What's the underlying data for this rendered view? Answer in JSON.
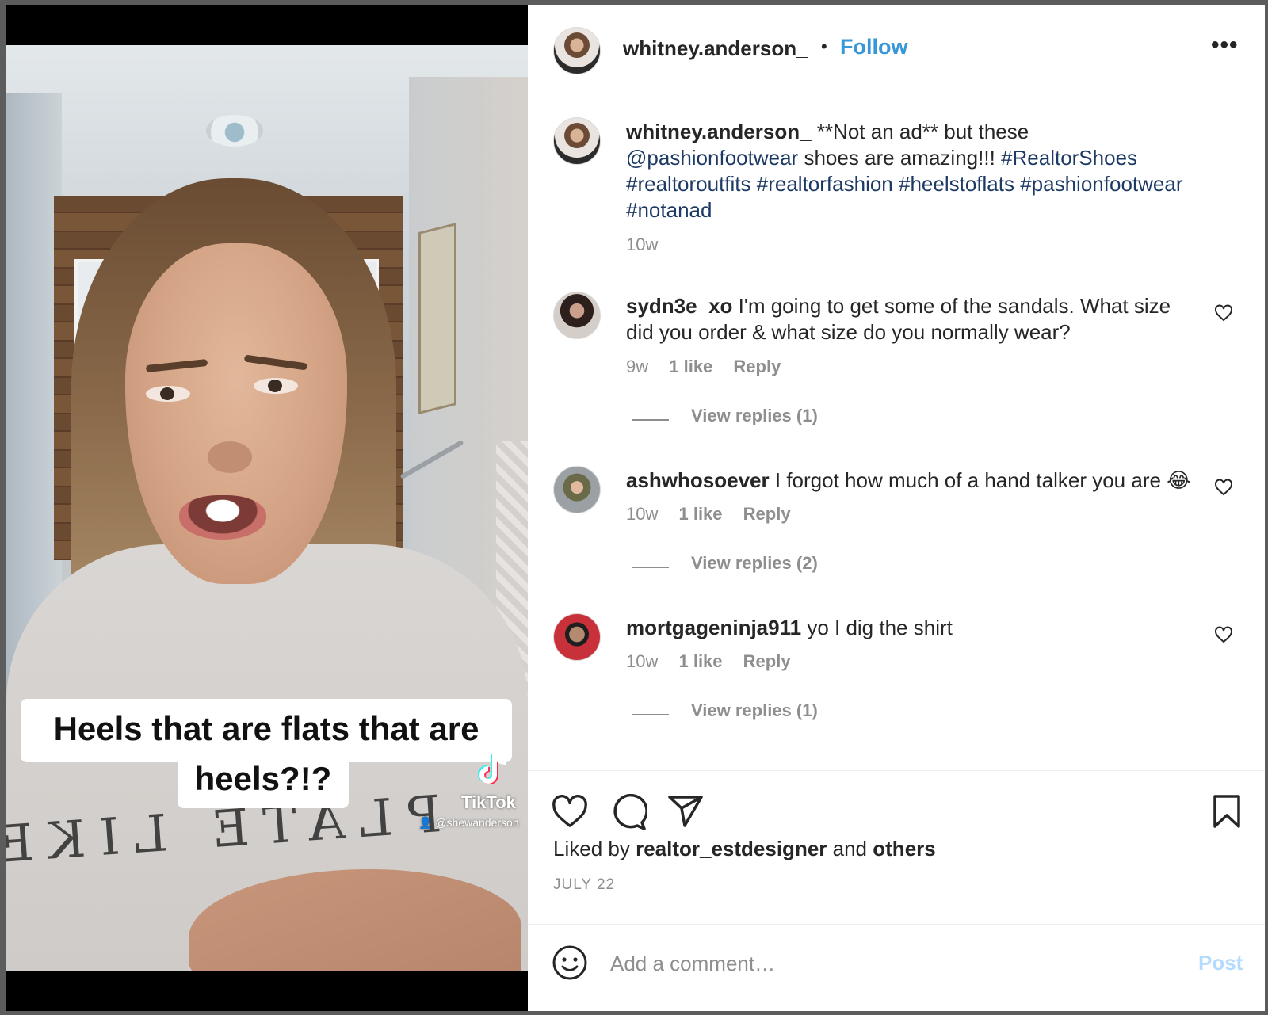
{
  "media": {
    "caption_line1": "Heels that are flats that are",
    "caption_line2": "heels?!?",
    "shirt_print": "PLATE LIKE",
    "watermark_brand": "TikTok",
    "watermark_user": "@shewanderson"
  },
  "header": {
    "username": "whitney.anderson_",
    "separator": "•",
    "follow_label": "Follow",
    "more_label": "•••"
  },
  "post": {
    "username": "whitney.anderson_",
    "text_before": "**Not an ad** but these",
    "mention": "@pashionfootwear",
    "text_after": "shoes are amazing!!!",
    "hashtag1": "#RealtorShoes",
    "hashtag2": "#realtoroutfits",
    "hashtag3": "#realtorfashion",
    "hashtag4": "#heelstoflats",
    "hashtag5": "#pashionfootwear",
    "hashtag6": "#notanad",
    "age": "10w"
  },
  "comments": [
    {
      "username": "sydn3e_xo",
      "text_line1": "I'm going to get some of the sandals. What size",
      "text_line2": "did you order & what size do you normally wear?",
      "age": "9w",
      "likes": "1 like",
      "reply": "Reply",
      "view_replies": "View replies (1)"
    },
    {
      "username": "ashwhosoever",
      "text_line1": "I forgot how much of a hand talker you are 😂",
      "age": "10w",
      "likes": "1 like",
      "reply": "Reply",
      "view_replies": "View replies (2)"
    },
    {
      "username": "mortgageninja911",
      "text_line1": "yo I dig the shirt",
      "age": "10w",
      "likes": "1 like",
      "reply": "Reply",
      "view_replies": "View replies (1)"
    }
  ],
  "footer": {
    "liked_by_prefix": "Liked by",
    "liked_by_user": "realtor_estdesigner",
    "liked_by_and": "and",
    "liked_by_others": "others",
    "date": "JULY 22",
    "comment_placeholder": "Add a comment…",
    "post_label": "Post"
  },
  "colors": {
    "follow_blue": "#3897d8",
    "hashtag_navy": "#1d3a64",
    "post_disabled": "#b3dbff"
  },
  "icons": [
    "more-icon",
    "heart-icon",
    "comment-icon",
    "share-icon",
    "bookmark-icon",
    "emoji-icon",
    "tiktok-icon"
  ]
}
